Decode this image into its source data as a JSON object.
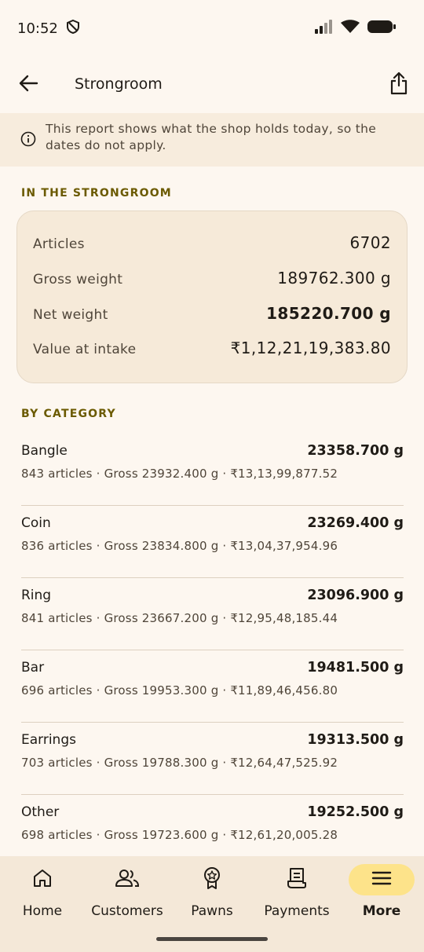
{
  "status_bar": {
    "time": "10:52"
  },
  "app_bar": {
    "title": "Strongroom"
  },
  "notice": {
    "text": "This report shows what the shop holds today, so the dates do not apply."
  },
  "strongroom": {
    "section_label": "IN THE STRONGROOM",
    "rows": [
      {
        "label": "Articles",
        "value": "6702"
      },
      {
        "label": "Gross weight",
        "value": "189762.300 g"
      },
      {
        "label": "Net weight",
        "value": "185220.700 g"
      },
      {
        "label": "Value at intake",
        "value": "₹1,12,21,19,383.80"
      }
    ]
  },
  "categories": {
    "section_label": "BY CATEGORY",
    "items": [
      {
        "name": "Bangle",
        "net": "23358.700 g",
        "details": "843 articles · Gross 23932.400 g · ₹13,13,99,877.52"
      },
      {
        "name": "Coin",
        "net": "23269.400 g",
        "details": "836 articles · Gross 23834.800 g · ₹13,04,37,954.96"
      },
      {
        "name": "Ring",
        "net": "23096.900 g",
        "details": "841 articles · Gross 23667.200 g · ₹12,95,48,185.44"
      },
      {
        "name": "Bar",
        "net": "19481.500 g",
        "details": "696 articles · Gross 19953.300 g · ₹11,89,46,456.80"
      },
      {
        "name": "Earrings",
        "net": "19313.500 g",
        "details": "703 articles · Gross 19788.300 g · ₹12,64,47,525.92"
      },
      {
        "name": "Other",
        "net": "19252.500 g",
        "details": "698 articles · Gross 19723.600 g · ₹12,61,20,005.28"
      }
    ]
  },
  "nav": {
    "items": [
      {
        "label": "Home",
        "icon": "home-icon"
      },
      {
        "label": "Customers",
        "icon": "customers-icon"
      },
      {
        "label": "Pawns",
        "icon": "pawns-icon"
      },
      {
        "label": "Payments",
        "icon": "payments-icon"
      },
      {
        "label": "More",
        "icon": "menu-icon",
        "active": true
      }
    ]
  },
  "colors": {
    "background": "#fdf7f0",
    "accent_label": "#6b5a00",
    "active_nav_pill": "#fde38a"
  }
}
